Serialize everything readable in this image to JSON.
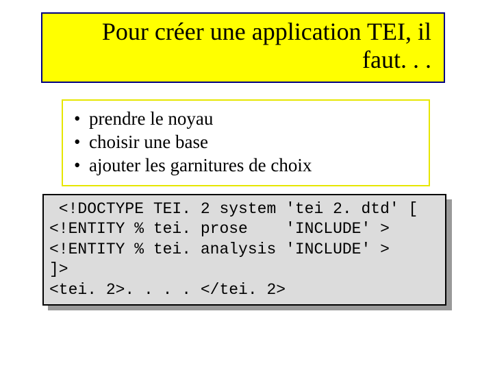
{
  "title": "Pour créer une application TEI, il faut. . .",
  "bullets": [
    "prendre le noyau",
    "choisir une base",
    "ajouter les garnitures de choix"
  ],
  "code": " <!DOCTYPE TEI. 2 system 'tei 2. dtd' [\n<!ENTITY % tei. prose    'INCLUDE' >\n<!ENTITY % tei. analysis 'INCLUDE' >\n]>\n<tei. 2>. . . . </tei. 2>"
}
